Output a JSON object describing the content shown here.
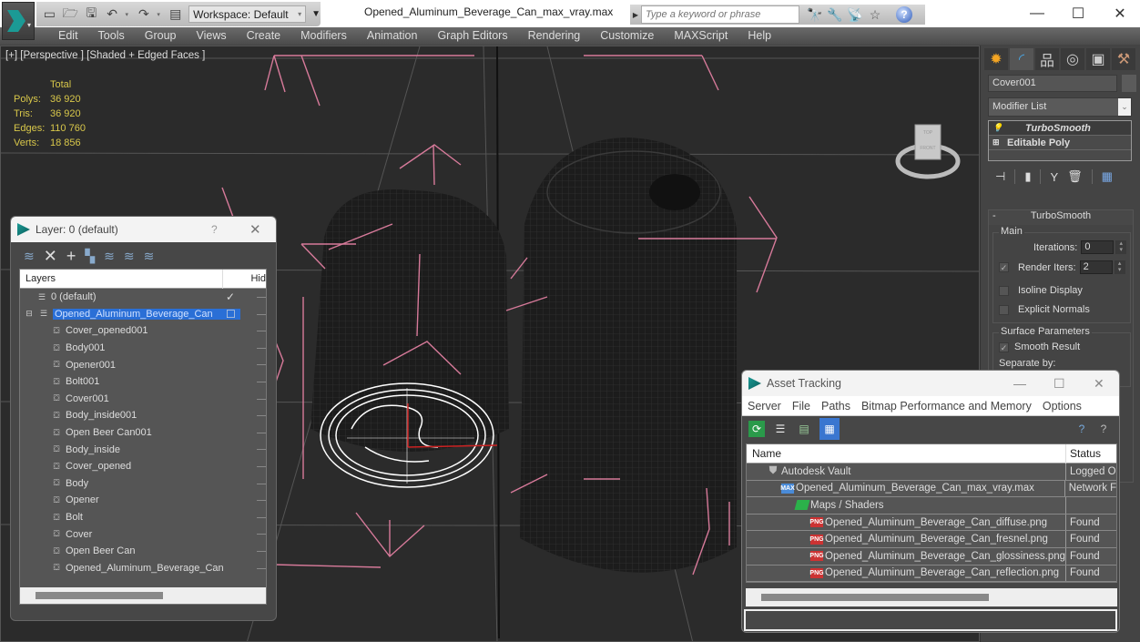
{
  "app": {
    "workspace_label": "Workspace: Default",
    "file_title": "Opened_Aluminum_Beverage_Can_max_vray.max",
    "search_placeholder": "Type a keyword or phrase",
    "window_controls": {
      "minimize": "—",
      "maximize": "☐",
      "close": "✕"
    }
  },
  "menu": [
    "Edit",
    "Tools",
    "Group",
    "Views",
    "Create",
    "Modifiers",
    "Animation",
    "Graph Editors",
    "Rendering",
    "Customize",
    "MAXScript",
    "Help"
  ],
  "viewport": {
    "label": "[+] [Perspective ] [Shaded + Edged Faces ]",
    "stats": {
      "header": "Total",
      "rows": [
        {
          "key": "Polys:",
          "value": "36 920"
        },
        {
          "key": "Tris:",
          "value": "36 920"
        },
        {
          "key": "Edges:",
          "value": "110 760"
        },
        {
          "key": "Verts:",
          "value": "18 856"
        }
      ]
    },
    "viewcube": {
      "top": "TOP",
      "front": "FRONT"
    }
  },
  "command_panel": {
    "object_name": "Cover001",
    "modifier_list": "Modifier List",
    "stack": [
      {
        "label": "TurboSmooth",
        "icon": "bulb-icon"
      },
      {
        "label": "Editable Poly",
        "icon": "plus-box-icon"
      }
    ],
    "rollout": {
      "title": "TurboSmooth",
      "collapse": "-",
      "main_group": "Main",
      "iterations_label": "Iterations:",
      "iterations_value": "0",
      "render_iters_label": "Render Iters:",
      "render_iters_value": "2",
      "render_iters_checked": true,
      "isoline_label": "Isoline Display",
      "isoline_checked": false,
      "explicit_normals_label": "Explicit Normals",
      "explicit_normals_checked": false,
      "surface_group": "Surface Parameters",
      "smooth_result_label": "Smooth Result",
      "smooth_result_checked": true,
      "separate_by_label": "Separate by:"
    }
  },
  "layer_dialog": {
    "title": "Layer: 0 (default)",
    "help": "?",
    "close": "✕",
    "col_layers": "Layers",
    "col_hide": "Hid",
    "rows": [
      {
        "name": "0 (default)",
        "type": "layer",
        "indent": 1,
        "check": "✓"
      },
      {
        "name": "Opened_Aluminum_Beverage_Can",
        "type": "layer",
        "indent": 0,
        "selected": true,
        "check": "☐"
      },
      {
        "name": "Cover_opened001",
        "type": "object",
        "indent": 2
      },
      {
        "name": "Body001",
        "type": "object",
        "indent": 2
      },
      {
        "name": "Opener001",
        "type": "object",
        "indent": 2
      },
      {
        "name": "Bolt001",
        "type": "object",
        "indent": 2
      },
      {
        "name": "Cover001",
        "type": "object",
        "indent": 2
      },
      {
        "name": "Body_inside001",
        "type": "object",
        "indent": 2
      },
      {
        "name": "Open Beer Can001",
        "type": "object",
        "indent": 2
      },
      {
        "name": "Body_inside",
        "type": "object",
        "indent": 2
      },
      {
        "name": "Cover_opened",
        "type": "object",
        "indent": 2
      },
      {
        "name": "Body",
        "type": "object",
        "indent": 2
      },
      {
        "name": "Opener",
        "type": "object",
        "indent": 2
      },
      {
        "name": "Bolt",
        "type": "object",
        "indent": 2
      },
      {
        "name": "Cover",
        "type": "object",
        "indent": 2
      },
      {
        "name": "Open Beer Can",
        "type": "object",
        "indent": 2
      },
      {
        "name": "Opened_Aluminum_Beverage_Can",
        "type": "object",
        "indent": 2
      }
    ]
  },
  "asset_dialog": {
    "title": "Asset Tracking",
    "menu": [
      "Server",
      "File",
      "Paths",
      "Bitmap Performance and Memory",
      "Options"
    ],
    "col_name": "Name",
    "col_status": "Status",
    "rows": [
      {
        "name": "Autodesk Vault",
        "status": "Logged O",
        "icon": "vault",
        "indent": 1
      },
      {
        "name": "Opened_Aluminum_Beverage_Can_max_vray.max",
        "status": "Network F",
        "icon": "max",
        "indent": 2
      },
      {
        "name": "Maps / Shaders",
        "status": "",
        "icon": "map",
        "indent": 3
      },
      {
        "name": "Opened_Aluminum_Beverage_Can_diffuse.png",
        "status": "Found",
        "icon": "png",
        "indent": 4
      },
      {
        "name": "Opened_Aluminum_Beverage_Can_fresnel.png",
        "status": "Found",
        "icon": "png",
        "indent": 4
      },
      {
        "name": "Opened_Aluminum_Beverage_Can_glossiness.png",
        "status": "Found",
        "icon": "png",
        "indent": 4
      },
      {
        "name": "Opened_Aluminum_Beverage_Can_reflection.png",
        "status": "Found",
        "icon": "png",
        "indent": 4
      }
    ],
    "path_value": ""
  },
  "colors": {
    "accent_teal": "#1b9a95",
    "selection_blue": "#2a6fd6",
    "stats_yellow": "#d8c74a",
    "helper_pink": "#d77a9a"
  }
}
